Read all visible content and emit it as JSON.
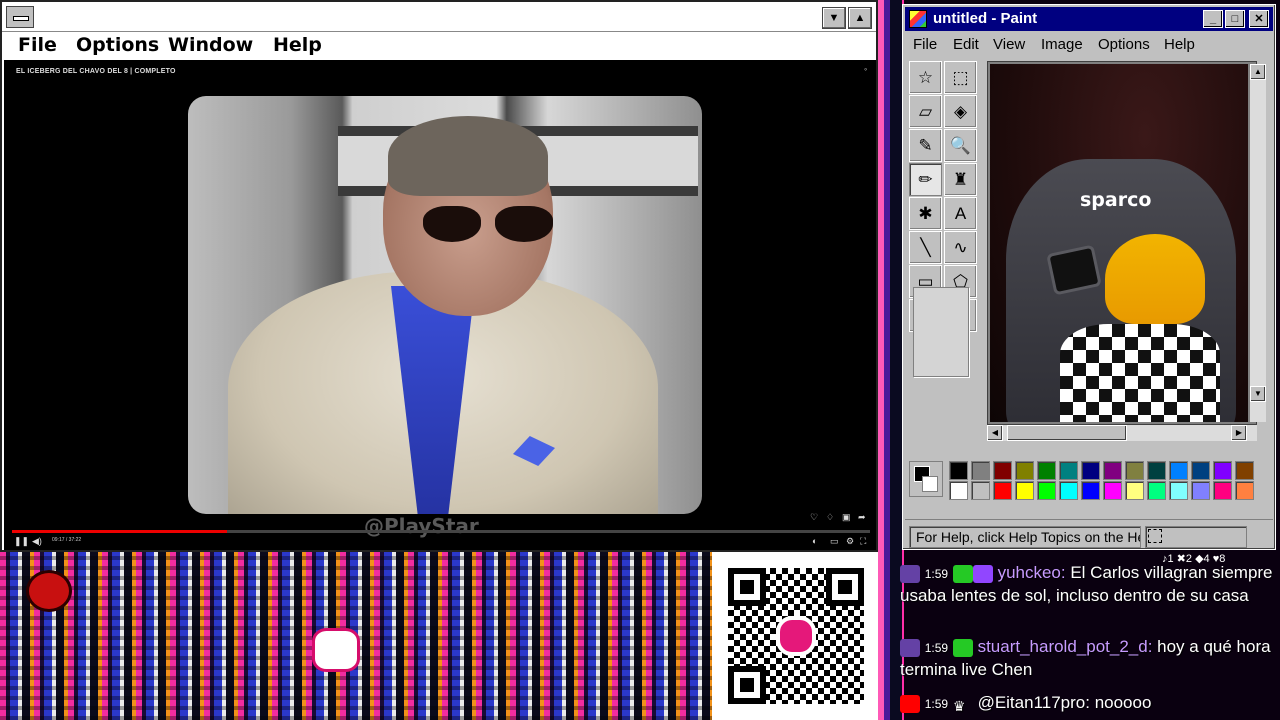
{
  "player": {
    "menu": [
      "File",
      "Options",
      "Window",
      "Help"
    ],
    "minimize": "▼",
    "maximize": "▲",
    "video_title": "EL ICEBERG DEL CHAVO DEL 8 | COMPLETO",
    "watermark": "@PlayStar",
    "time": "09:17 / 37:22",
    "progress": 0.25
  },
  "paint": {
    "title": "untitled - Paint",
    "menu": [
      "File",
      "Edit",
      "View",
      "Image",
      "Options",
      "Help"
    ],
    "controls": {
      "minimize": "_",
      "maximize": "□",
      "close": "✕"
    },
    "canvas_logo": "sparco",
    "status": "For Help, click Help Topics on the Help Menu.",
    "tools": [
      {
        "icon": "free-select-icon",
        "glyph": "☆"
      },
      {
        "icon": "rect-select-icon",
        "glyph": "⬚"
      },
      {
        "icon": "eraser-icon",
        "glyph": "▱"
      },
      {
        "icon": "fill-icon",
        "glyph": "◈"
      },
      {
        "icon": "color-picker-icon",
        "glyph": "✎"
      },
      {
        "icon": "magnifier-icon",
        "glyph": "🔍"
      },
      {
        "icon": "pencil-icon",
        "glyph": "✏",
        "pressed": true
      },
      {
        "icon": "brush-icon",
        "glyph": "♜"
      },
      {
        "icon": "airbrush-icon",
        "glyph": "✱"
      },
      {
        "icon": "text-icon",
        "glyph": "A"
      },
      {
        "icon": "line-icon",
        "glyph": "╲"
      },
      {
        "icon": "curve-icon",
        "glyph": "∿"
      },
      {
        "icon": "rectangle-icon",
        "glyph": "▭"
      },
      {
        "icon": "polygon-icon",
        "glyph": "⬠"
      },
      {
        "icon": "ellipse-icon",
        "glyph": "⬭"
      },
      {
        "icon": "rounded-rect-icon",
        "glyph": "▢"
      }
    ],
    "palette_top": [
      "#000000",
      "#808080",
      "#800000",
      "#808000",
      "#008000",
      "#008080",
      "#000080",
      "#800080",
      "#808040",
      "#004040",
      "#0080ff",
      "#004080",
      "#8000ff",
      "#804000"
    ],
    "palette_bottom": [
      "#ffffff",
      "#c0c0c0",
      "#ff0000",
      "#ffff00",
      "#00ff00",
      "#00ffff",
      "#0000ff",
      "#ff00ff",
      "#ffff80",
      "#00ff80",
      "#80ffff",
      "#8080ff",
      "#ff0080",
      "#ff8040"
    ]
  },
  "chat": {
    "stats": "♪1 ✖2 ◆4 ♥8",
    "messages": [
      {
        "platform": "twitch",
        "time": "1:59",
        "user": "yuhckeo:",
        "user_color": "#c79bff",
        "text": " El Carlos villagran siempre usaba lentes de sol, incluso dentro de su casa"
      },
      {
        "platform": "twitch",
        "time": "1:59",
        "user": "stuart_harold_pot_2_d:",
        "user_color": "#c79bff",
        "text": " hoy a qué hora termina live Chen"
      },
      {
        "platform": "youtube",
        "time": "1:59",
        "user": "@Eitan117pro:",
        "user_color": "#ffffff",
        "text": " nooooo"
      }
    ]
  }
}
